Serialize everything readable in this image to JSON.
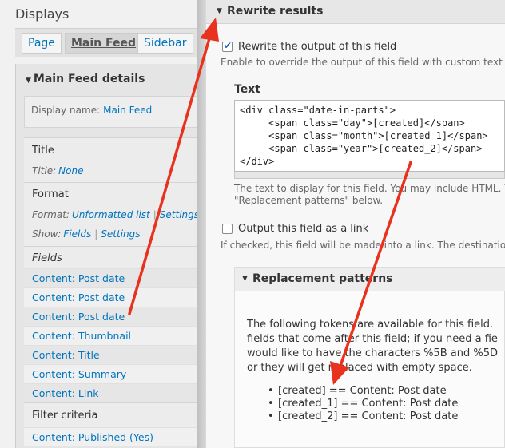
{
  "left": {
    "title": "Displays",
    "tabs": [
      "Page",
      "Main Feed",
      "Sidebar"
    ],
    "details_title": "Main Feed details",
    "display_name_label": "Display name:",
    "display_name_value": "Main Feed",
    "title_section": "Title",
    "title_meta_label": "Title:",
    "title_meta_value": "None",
    "format_section": "Format",
    "format_meta_label": "Format:",
    "format_meta_value": "Unformatted list",
    "format_settings": "Settings",
    "show_meta_label": "Show:",
    "show_meta_value": "Fields",
    "show_settings": "Settings",
    "fields_section": "Fields",
    "fields": [
      "Content: Post date",
      "Content: Post date",
      "Content: Post date",
      "Content: Thumbnail",
      "Content: Title",
      "Content: Summary",
      "Content: Link"
    ],
    "filter_section": "Filter criteria",
    "filters": [
      "Content: Published (Yes)"
    ]
  },
  "right": {
    "rewrite_title": "Rewrite results",
    "rewrite_checkbox_label": "Rewrite the output of this field",
    "rewrite_desc": "Enable to override the output of this field with custom text e",
    "text_label": "Text",
    "code_lines": [
      "<div class=\"date-in-parts\">",
      "     <span class=\"day\">[created]</span>",
      "     <span class=\"month\">[created_1]</span>",
      "     <span class=\"year\">[created_2]</span>",
      "</div>"
    ],
    "text_desc_1": "The text to display for this field. You may include HTML. Y",
    "text_desc_2": "\"Replacement patterns\" below.",
    "link_checkbox_label": "Output this field as a link",
    "link_desc": "If checked, this field will be made into a link. The destination",
    "rp_title": "Replacement patterns",
    "rp_paragraph": [
      "The following tokens are available for this field. ",
      "fields that come after this field; if you need a fie",
      "would like to have the characters %5B and %5D",
      "or they will get replaced with empty space."
    ],
    "rp_tokens": [
      "[created] == Content: Post date",
      "[created_1] == Content: Post date",
      "[created_2] == Content: Post date"
    ]
  },
  "colors": {
    "link": "#0074bd",
    "arrow": "#e8321e"
  }
}
